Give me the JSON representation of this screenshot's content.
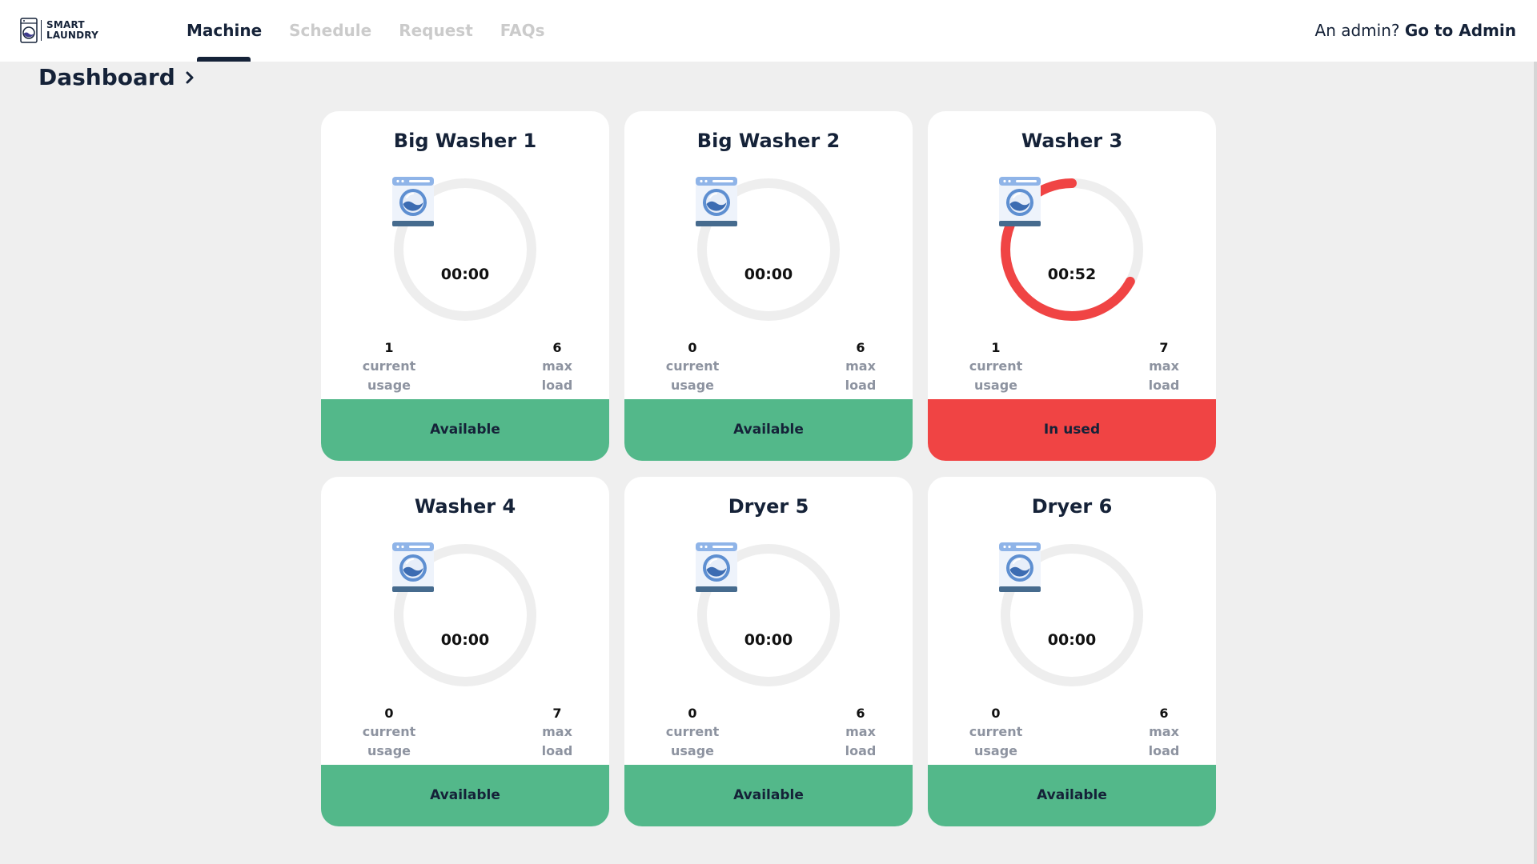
{
  "brand": {
    "line1": "SMART",
    "line2": "LAUNDRY"
  },
  "nav": {
    "tabs": [
      {
        "label": "Machine",
        "active": true
      },
      {
        "label": "Schedule",
        "active": false
      },
      {
        "label": "Request",
        "active": false
      },
      {
        "label": "FAQs",
        "active": false
      }
    ],
    "admin_prompt": "An admin?",
    "admin_link": "Go to Admin"
  },
  "page": {
    "title": "Dashboard",
    "breadcrumb_icon": "chevron-right-icon"
  },
  "colors": {
    "available": "#53b88a",
    "in_use": "#f04444",
    "ring_track": "#eeeeee",
    "text_dark": "#152238"
  },
  "machines": [
    {
      "name": "Big Washer 1",
      "icon": "washing-machine-icon",
      "timer": "00:00",
      "progress": 0,
      "current_usage": "1",
      "current_usage_label": "current usage",
      "max_load": "6",
      "max_load_label": "max load",
      "status": "Available",
      "status_key": "available"
    },
    {
      "name": "Big Washer 2",
      "icon": "washing-machine-icon",
      "timer": "00:00",
      "progress": 0,
      "current_usage": "0",
      "current_usage_label": "current usage",
      "max_load": "6",
      "max_load_label": "max load",
      "status": "Available",
      "status_key": "available"
    },
    {
      "name": "Washer 3",
      "icon": "washing-machine-icon",
      "timer": "00:52",
      "progress": 0.67,
      "current_usage": "1",
      "current_usage_label": "current usage",
      "max_load": "7",
      "max_load_label": "max load",
      "status": "In used",
      "status_key": "inuse"
    },
    {
      "name": "Washer 4",
      "icon": "washing-machine-icon",
      "timer": "00:00",
      "progress": 0,
      "current_usage": "0",
      "current_usage_label": "current usage",
      "max_load": "7",
      "max_load_label": "max load",
      "status": "Available",
      "status_key": "available"
    },
    {
      "name": "Dryer 5",
      "icon": "washing-machine-icon",
      "timer": "00:00",
      "progress": 0,
      "current_usage": "0",
      "current_usage_label": "current usage",
      "max_load": "6",
      "max_load_label": "max load",
      "status": "Available",
      "status_key": "available"
    },
    {
      "name": "Dryer 6",
      "icon": "washing-machine-icon",
      "timer": "00:00",
      "progress": 0,
      "current_usage": "0",
      "current_usage_label": "current usage",
      "max_load": "6",
      "max_load_label": "max load",
      "status": "Available",
      "status_key": "available"
    }
  ]
}
